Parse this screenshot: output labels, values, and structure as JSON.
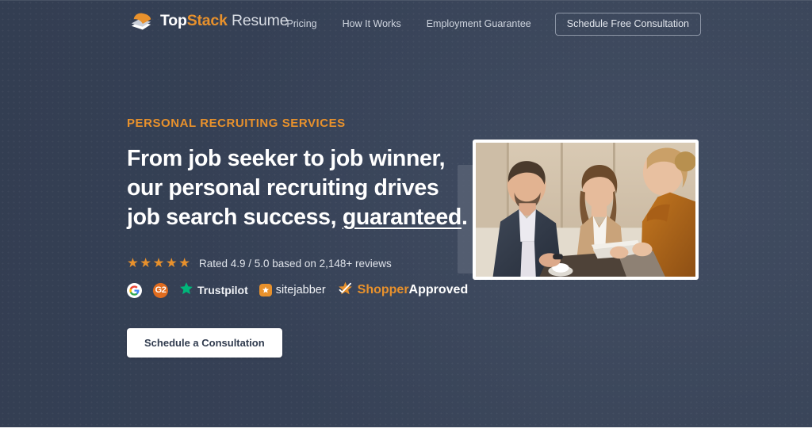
{
  "brand": {
    "logo_icon": "stacked-papers-icon",
    "name_part1": "Top",
    "name_part2": "Stack",
    "name_part3": "Resume",
    "accent_color": "#e8912c"
  },
  "nav": {
    "links": [
      {
        "label": "Pricing"
      },
      {
        "label": "How It Works"
      },
      {
        "label": "Employment Guarantee"
      }
    ],
    "cta_label": "Schedule Free Consultation"
  },
  "hero": {
    "eyebrow": "PERSONAL RECRUITING SERVICES",
    "headline_line1": "From job seeker to job winner,",
    "headline_line2": "our personal recruiting drives",
    "headline_line3_pre": "job search success, ",
    "headline_line3_underlined": "guaranteed",
    "headline_line3_post": ".",
    "cta_label": "Schedule a Consultation",
    "background_color": "#364156",
    "image_alt": "Three business professionals smiling during a consultation meeting at a table"
  },
  "rating": {
    "stars": "★★★★★",
    "star_count": 5,
    "score": "4.9",
    "scale": "5.0",
    "review_count": "2,148+",
    "text": "Rated 4.9 / 5.0 based on 2,148+ reviews",
    "star_color": "#e8912c"
  },
  "review_badges": [
    {
      "name": "google",
      "icon": "google-g-icon",
      "label": ""
    },
    {
      "name": "g2",
      "icon": "g2-icon",
      "label": ""
    },
    {
      "name": "trustpilot",
      "icon": "trustpilot-star-icon",
      "label": "Trustpilot",
      "color": "#00b67a"
    },
    {
      "name": "sitejabber",
      "icon": "sitejabber-star-icon",
      "label": "sitejabber",
      "color": "#e8912c"
    },
    {
      "name": "shopper-approved",
      "icon": "shopper-approved-star-icon",
      "label_orange": "Shopper",
      "label_white": "Approved"
    }
  ]
}
